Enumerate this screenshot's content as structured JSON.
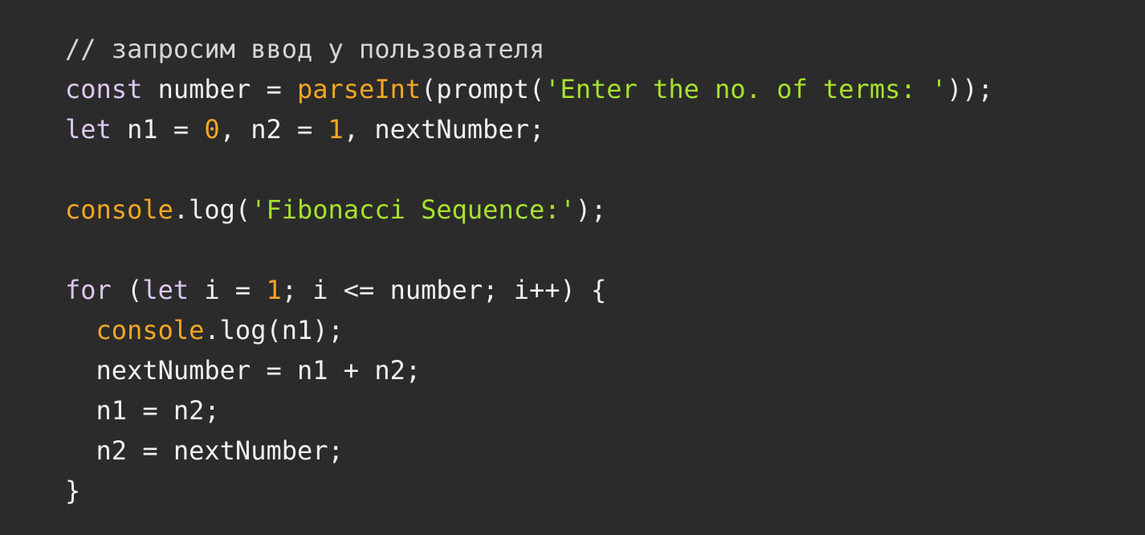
{
  "code": {
    "language": "javascript",
    "lines": [
      [
        {
          "t": "comment",
          "v": "// запросим ввод у пользователя"
        }
      ],
      [
        {
          "t": "keyword",
          "v": "const"
        },
        {
          "t": "plain",
          "v": " number = "
        },
        {
          "t": "func",
          "v": "parseInt"
        },
        {
          "t": "plain",
          "v": "(prompt("
        },
        {
          "t": "string",
          "v": "'Enter the no. of terms: '"
        },
        {
          "t": "plain",
          "v": "));"
        }
      ],
      [
        {
          "t": "keyword",
          "v": "let"
        },
        {
          "t": "plain",
          "v": " n1 = "
        },
        {
          "t": "number",
          "v": "0"
        },
        {
          "t": "plain",
          "v": ", n2 = "
        },
        {
          "t": "number",
          "v": "1"
        },
        {
          "t": "plain",
          "v": ", nextNumber;"
        }
      ],
      [],
      [
        {
          "t": "func",
          "v": "console"
        },
        {
          "t": "plain",
          "v": ".log("
        },
        {
          "t": "string",
          "v": "'Fibonacci Sequence:'"
        },
        {
          "t": "plain",
          "v": ");"
        }
      ],
      [],
      [
        {
          "t": "keyword",
          "v": "for"
        },
        {
          "t": "plain",
          "v": " ("
        },
        {
          "t": "keyword",
          "v": "let"
        },
        {
          "t": "plain",
          "v": " i = "
        },
        {
          "t": "number",
          "v": "1"
        },
        {
          "t": "plain",
          "v": "; i <= number; i++) {"
        }
      ],
      [
        {
          "t": "plain",
          "v": "  "
        },
        {
          "t": "func",
          "v": "console"
        },
        {
          "t": "plain",
          "v": ".log(n1);"
        }
      ],
      [
        {
          "t": "plain",
          "v": "  nextNumber = n1 + n2;"
        }
      ],
      [
        {
          "t": "plain",
          "v": "  n1 = n2;"
        }
      ],
      [
        {
          "t": "plain",
          "v": "  n2 = nextNumber;"
        }
      ],
      [
        {
          "t": "plain",
          "v": "}"
        }
      ]
    ]
  },
  "colors": {
    "background": "#2b2b2b",
    "plain": "#f0f0f0",
    "comment": "#d6d6d6",
    "keyword": "#ddc7f0",
    "function": "#f5a623",
    "string": "#a6e22e",
    "number": "#f5a623"
  }
}
